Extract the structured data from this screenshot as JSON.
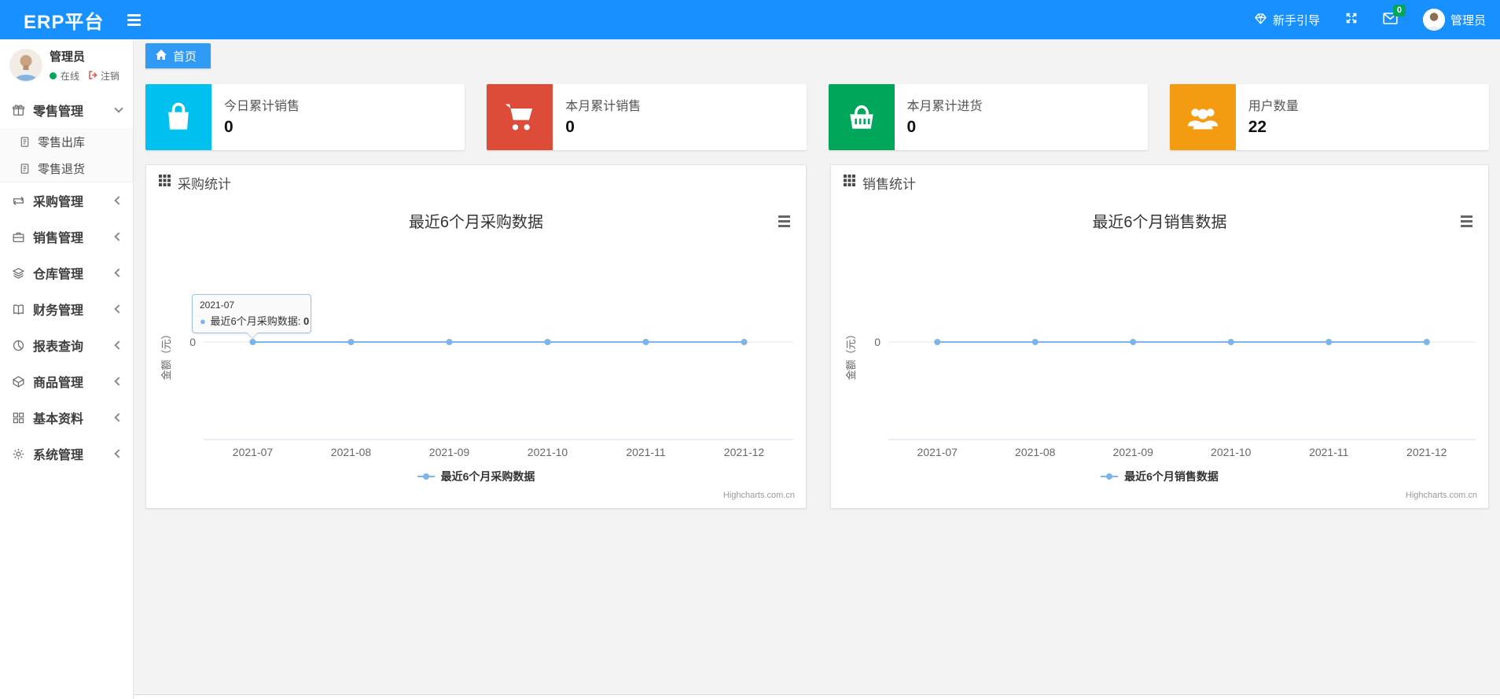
{
  "navbar": {
    "brand": "ERP平台",
    "guide_label": "新手引导",
    "mail_badge": "0",
    "username": "管理员"
  },
  "sidebar": {
    "user": {
      "name": "管理员",
      "status_label": "在线",
      "logout_label": "注销"
    },
    "menu": [
      {
        "id": "retail",
        "label": "零售管理",
        "icon": "gift-icon",
        "expanded": true,
        "children": [
          {
            "id": "retail-out",
            "label": "零售出库",
            "icon": "doc-icon"
          },
          {
            "id": "retail-return",
            "label": "零售退货",
            "icon": "doc-icon"
          }
        ]
      },
      {
        "id": "purchase",
        "label": "采购管理",
        "icon": "exchange-icon"
      },
      {
        "id": "sales",
        "label": "销售管理",
        "icon": "briefcase-icon"
      },
      {
        "id": "warehouse",
        "label": "仓库管理",
        "icon": "layers-icon"
      },
      {
        "id": "finance",
        "label": "财务管理",
        "icon": "book-icon"
      },
      {
        "id": "reports",
        "label": "报表查询",
        "icon": "pie-icon"
      },
      {
        "id": "goods",
        "label": "商品管理",
        "icon": "box-icon"
      },
      {
        "id": "basic",
        "label": "基本资料",
        "icon": "grid-icon"
      },
      {
        "id": "system",
        "label": "系统管理",
        "icon": "gear-icon"
      }
    ]
  },
  "breadcrumb": {
    "home_label": "首页"
  },
  "stat_cards": [
    {
      "label": "今日累计销售",
      "value": "0",
      "color": "#00c0ef",
      "icon": "bag-icon"
    },
    {
      "label": "本月累计销售",
      "value": "0",
      "color": "#dd4b39",
      "icon": "cart-icon"
    },
    {
      "label": "本月累计进货",
      "value": "0",
      "color": "#00a65a",
      "icon": "basket-icon"
    },
    {
      "label": "用户数量",
      "value": "22",
      "color": "#f39c12",
      "icon": "users-icon"
    }
  ],
  "panels": [
    {
      "header": "采购统计"
    },
    {
      "header": "销售统计"
    }
  ],
  "chart_data": [
    {
      "type": "line",
      "title": "最近6个月采购数据",
      "categories": [
        "2021-07",
        "2021-08",
        "2021-09",
        "2021-10",
        "2021-11",
        "2021-12"
      ],
      "series": [
        {
          "name": "最近6个月采购数据",
          "values": [
            0,
            0,
            0,
            0,
            0,
            0
          ],
          "color": "#7cb5ec"
        }
      ],
      "ylabel": "金额（元）",
      "yticks": [
        "0"
      ],
      "grid": false,
      "legend_position": "bottom",
      "credits": "Highcharts.com.cn",
      "tooltip": {
        "visible": true,
        "category": "2021-07",
        "series_label": "最近6个月采购数据",
        "value": "0"
      }
    },
    {
      "type": "line",
      "title": "最近6个月销售数据",
      "categories": [
        "2021-07",
        "2021-08",
        "2021-09",
        "2021-10",
        "2021-11",
        "2021-12"
      ],
      "series": [
        {
          "name": "最近6个月销售数据",
          "values": [
            0,
            0,
            0,
            0,
            0,
            0
          ],
          "color": "#7cb5ec"
        }
      ],
      "ylabel": "金额（元）",
      "yticks": [
        "0"
      ],
      "grid": false,
      "legend_position": "bottom",
      "credits": "Highcharts.com.cn",
      "tooltip": {
        "visible": false
      }
    }
  ]
}
